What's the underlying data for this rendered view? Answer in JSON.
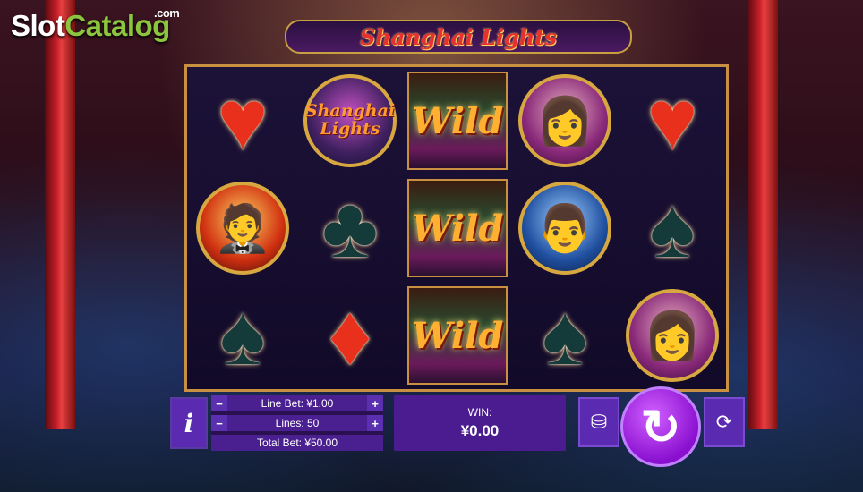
{
  "logo": {
    "slot": "Slot",
    "catalog": "Catalog",
    "com": ".com"
  },
  "title": "Shanghai Lights",
  "reels": [
    [
      "heart",
      "man1",
      "spade"
    ],
    [
      "scatter",
      "club",
      "diamond"
    ],
    [
      "wild",
      "wild",
      "wild"
    ],
    [
      "woman",
      "man2",
      "spade"
    ],
    [
      "heart",
      "spade",
      "woman"
    ]
  ],
  "symbols": {
    "heart": "♥",
    "diamond": "♦",
    "club": "♣",
    "spade": "♠",
    "wild": "Wild",
    "scatter": [
      "Shanghai",
      "Lights"
    ]
  },
  "bets": {
    "line_bet_label": "Line Bet: ¥1.00",
    "lines_label": "Lines: 50",
    "total_bet_label": "Total Bet: ¥50.00",
    "minus": "−",
    "plus": "+"
  },
  "win": {
    "label": "WIN:",
    "value": "¥0.00"
  },
  "info_label": "i",
  "icons": {
    "info": "info-icon",
    "coins": "coins-stack-icon",
    "spin": "spin-arrow-icon",
    "autoplay": "autoplay-icon"
  },
  "colors": {
    "accent": "#8a10d0",
    "panel": "#3a1a70",
    "frame": "#c89040"
  }
}
